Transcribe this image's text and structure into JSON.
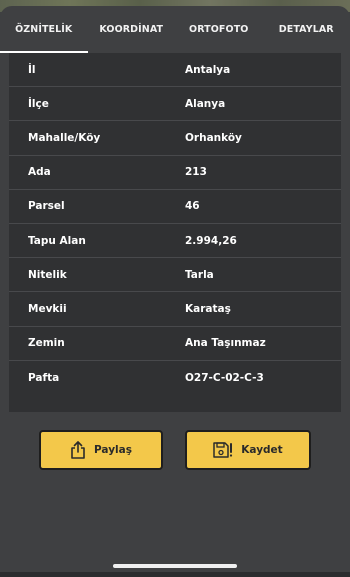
{
  "tabs": [
    {
      "label": "ÖZNİTELİK"
    },
    {
      "label": "KOORDİNAT"
    },
    {
      "label": "ORTOFOTO"
    },
    {
      "label": "DETAYLAR"
    }
  ],
  "active_tab": "ÖZNİTELİK",
  "attributes": [
    {
      "key": "İl",
      "value": "Antalya"
    },
    {
      "key": "İlçe",
      "value": "Alanya"
    },
    {
      "key": "Mahalle/Köy",
      "value": "Orhanköy"
    },
    {
      "key": "Ada",
      "value": "213"
    },
    {
      "key": "Parsel",
      "value": "46"
    },
    {
      "key": "Tapu Alan",
      "value": "2.994,26"
    },
    {
      "key": "Nitelik",
      "value": "Tarla"
    },
    {
      "key": "Mevkii",
      "value": "Karataş"
    },
    {
      "key": "Zemin",
      "value": "Ana Taşınmaz"
    },
    {
      "key": "Pafta",
      "value": "O27-C-02-C-3"
    }
  ],
  "buttons": {
    "share_label": "Paylaş",
    "save_label": "Kaydet",
    "share_icon": "share-icon",
    "save_icon": "floppy-disk-icon"
  },
  "colors": {
    "background": "#3f4042",
    "panel": "#303133",
    "accent": "#f3c84a",
    "text": "#ffffff"
  }
}
